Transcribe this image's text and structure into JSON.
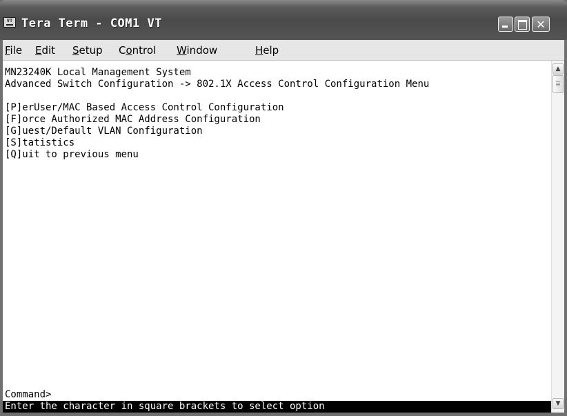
{
  "window": {
    "title": "Tera Term - COM1 VT",
    "icon": "teraterm-app-icon"
  },
  "title_buttons": {
    "minimize": "minimize-icon",
    "maximize": "maximize-icon",
    "close": "close-icon",
    "close_glyph": "✕"
  },
  "menu": {
    "items": [
      {
        "label": "File",
        "mnemonic": "F",
        "rest": "ile"
      },
      {
        "label": "Edit",
        "mnemonic": "E",
        "rest": "dit"
      },
      {
        "label": "Setup",
        "mnemonic": "S",
        "rest": "etup"
      },
      {
        "label": "Control",
        "pre": "C",
        "mnemonic": "o",
        "rest": "ntrol"
      },
      {
        "label": "Window",
        "mnemonic": "W",
        "rest": "indow"
      },
      {
        "label": "Help",
        "mnemonic": "H",
        "rest": "elp"
      }
    ]
  },
  "terminal": {
    "lines": [
      "MN23240K Local Management System",
      "Advanced Switch Configuration -> 802.1X Access Control Configuration Menu",
      "",
      "[P]erUser/MAC Based Access Control Configuration",
      "[F]orce Authorized MAC Address Configuration",
      "[G]uest/Default VLAN Configuration",
      "[S]tatistics",
      "[Q]uit to previous menu"
    ],
    "prompt": "Command>",
    "status": "Enter the character in square brackets to select option"
  },
  "scrollbar": {
    "up_arrow": "▲",
    "down_arrow": "▼"
  },
  "colors": {
    "titlebar": "#4a4a4a",
    "menubar": "#e6e6e6",
    "terminal_bg": "#ffffff",
    "terminal_fg": "#000000",
    "status_bg": "#000000",
    "status_fg": "#ffffff"
  }
}
